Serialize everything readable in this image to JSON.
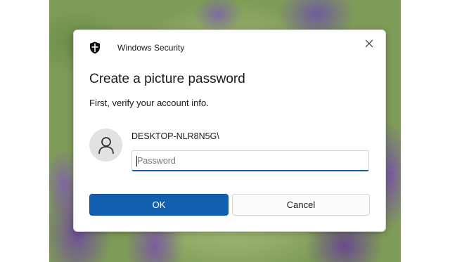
{
  "window": {
    "app_title": "Windows Security",
    "close_icon": "close-icon"
  },
  "dialog": {
    "heading": "Create a picture password",
    "subtext": "First, verify your account info.",
    "account_name": "DESKTOP-NLR8N5G\\",
    "password_placeholder": "Password",
    "password_value": ""
  },
  "buttons": {
    "ok_label": "OK",
    "cancel_label": "Cancel"
  },
  "icons": {
    "shield": "shield-icon",
    "avatar": "user-avatar-icon"
  },
  "colors": {
    "accent": "#1460b0",
    "input_focus_underline": "#1a5fa8"
  }
}
